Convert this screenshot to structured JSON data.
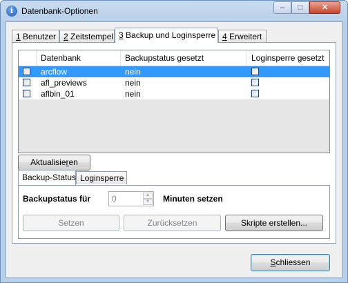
{
  "window": {
    "title": "Datenbank-Optionen",
    "icon_name": "info-icon",
    "controls": {
      "minimize": "–",
      "maximize": "□",
      "close": "✕"
    }
  },
  "tabs": [
    {
      "accel": "1",
      "label": " Benutzer"
    },
    {
      "accel": "2",
      "label": " Zeitstempel"
    },
    {
      "accel": "3",
      "label": " Backup und Loginsperre"
    },
    {
      "accel": "4",
      "label": " Erweitert"
    }
  ],
  "active_tab": 2,
  "table": {
    "columns": [
      "Datenbank",
      "Backupstatus gesetzt",
      "Loginsperre gesetzt"
    ],
    "rows": [
      {
        "name": "arcflow",
        "backup": "nein",
        "selected": true,
        "checked": false,
        "lock": false
      },
      {
        "name": "afl_previews",
        "backup": "nein",
        "selected": false,
        "checked": false,
        "lock": false
      },
      {
        "name": "aflbin_01",
        "backup": "nein",
        "selected": false,
        "checked": false,
        "lock": false
      }
    ]
  },
  "refresh_button": {
    "pre": "Aktualisie",
    "accel": "r",
    "post": "en"
  },
  "subtabs": [
    "Backup-Status",
    "Loginsperre"
  ],
  "backup": {
    "label_prefix": "Backupstatus für",
    "spin_value": "0",
    "spin_up": "▲",
    "spin_down": "▼",
    "label_suffix": "Minuten setzen"
  },
  "actions": {
    "set": "Setzen",
    "reset": "Zurücksetzen",
    "scripts": "Skripte erstellen..."
  },
  "close_button": {
    "accel": "S",
    "post": "chliessen"
  },
  "colors": {
    "selection": "#3399ff",
    "title_bg": "#b9d0ea"
  }
}
